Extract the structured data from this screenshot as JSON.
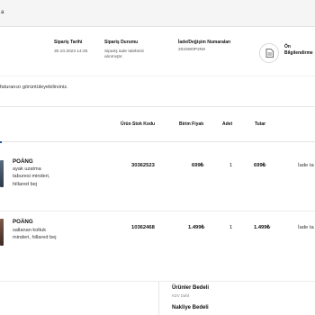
{
  "topbar": {
    "fragment": "a"
  },
  "summary": {
    "order_date_label": "Sipariş Tarihi",
    "order_date_value": "30.10.2023 14:25",
    "order_status_label": "Sipariş Durumu",
    "order_status_value_1": "Sipariş iade talebiniz",
    "order_status_value_2": "alınmıştır.",
    "return_numbers_label": "İade/Değişim Numaraları",
    "return_numbers_value": "2023W0P2N9",
    "info_label_1": "Ön",
    "info_label_2": "Bilgilendirme"
  },
  "note": "faturanızı görüntüleyebilirsiniz.",
  "table": {
    "headers": {
      "code": "Ürün Stok Kodu",
      "price": "Birim Fiyatı",
      "qty": "Adet",
      "total": "Tutar"
    },
    "rows": [
      {
        "name": "POÄNG",
        "desc_1": "ayak uzatma",
        "desc_2": "taburesi minderi,",
        "desc_3": "hillared bej",
        "code": "30362523",
        "price": "699₺",
        "qty": "1",
        "total": "699₺",
        "action": "İade ta"
      },
      {
        "name": "POÄNG",
        "desc_1": "sallanan koltuk",
        "desc_2": "minderi, hillared bej",
        "code": "10362468",
        "price": "1.499₺",
        "qty": "1",
        "total": "1.499₺",
        "action": "İade ta"
      }
    ]
  },
  "totals": {
    "products_label": "Ürünler Bedeli",
    "vat_note": "KDV Dahil",
    "shipping_label": "Nakliye Bedeli"
  },
  "icons": {
    "info_button": "document-icon"
  },
  "colors": {
    "accent": "#1a56a8",
    "topbar_bg": "#f5f5f5"
  }
}
